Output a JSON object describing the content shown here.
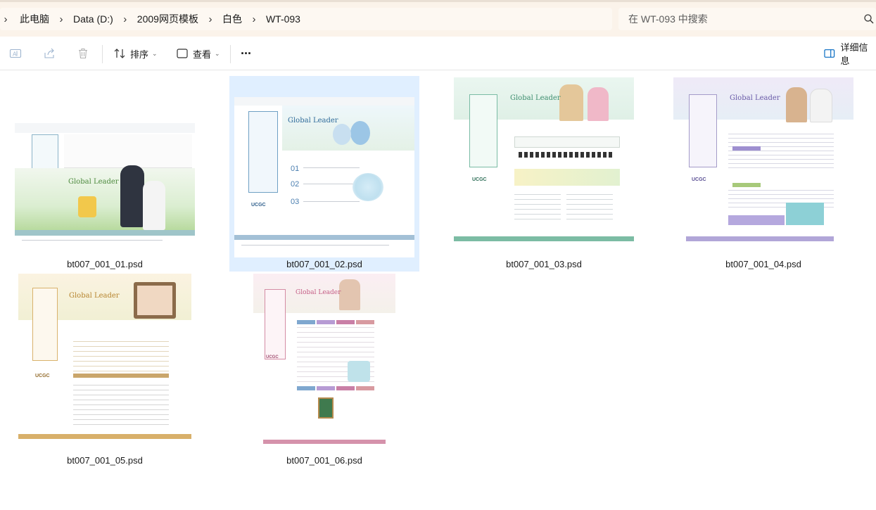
{
  "breadcrumb": {
    "items": [
      "此电脑",
      "Data (D:)",
      "2009网页模板",
      "白色",
      "WT-093"
    ]
  },
  "search": {
    "placeholder": "在 WT-093 中搜索"
  },
  "toolbar": {
    "sort_label": "排序",
    "view_label": "查看",
    "more_label": "···",
    "details_label": "详细信息"
  },
  "thumbnail_text": {
    "headline": "Global Leader",
    "logo_text": "UCGC",
    "step_numbers": [
      "01",
      "02",
      "03"
    ]
  },
  "files": [
    {
      "name": "bt007_001_01.psd",
      "selected": false
    },
    {
      "name": "bt007_001_02.psd",
      "selected": true
    },
    {
      "name": "bt007_001_03.psd",
      "selected": false
    },
    {
      "name": "bt007_001_04.psd",
      "selected": false
    },
    {
      "name": "bt007_001_05.psd",
      "selected": false
    },
    {
      "name": "bt007_001_06.psd",
      "selected": false
    }
  ],
  "colors": {
    "accent": "#0067c0",
    "selection": "#e0efff",
    "address_bg": "#fbf3ea"
  }
}
